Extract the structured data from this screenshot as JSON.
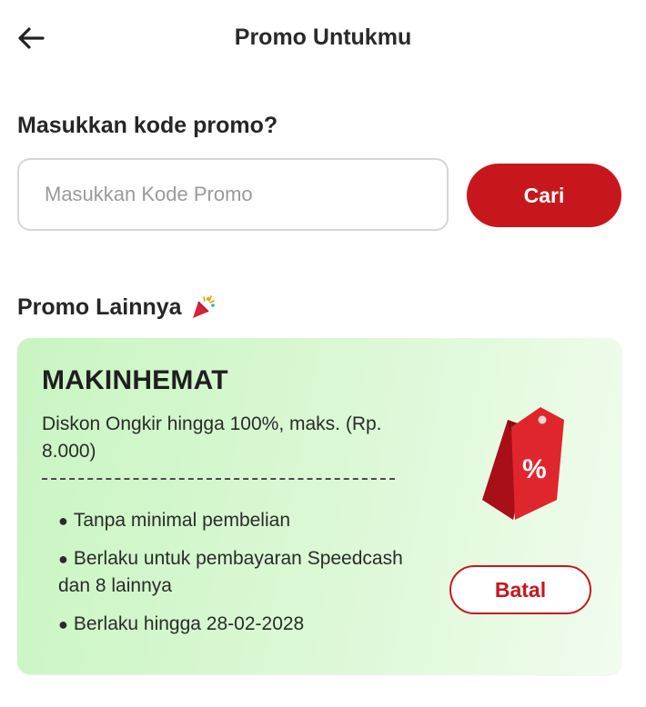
{
  "header": {
    "back_icon": "arrow-left-icon",
    "title": "Promo Untukmu"
  },
  "promo_input": {
    "label": "Masukkan kode promo?",
    "value": "",
    "placeholder": "Masukkan Kode Promo",
    "search_label": "Cari"
  },
  "other_promos": {
    "label": "Promo Lainnya",
    "label_icon": "party-popper-icon",
    "items": [
      {
        "code": "MAKINHEMAT",
        "description": "Diskon Ongkir hingga 100%, maks. (Rp. 8.000)",
        "terms": [
          "Tanpa minimal pembelian",
          "Berlaku untuk pembayaran Speedcash dan 8 lainnya",
          "Berlaku hingga 28-02-2028"
        ],
        "icon": "discount-tag-icon",
        "action_label": "Batal"
      }
    ]
  },
  "colors": {
    "accent": "#c8171c",
    "card_bg_start": "#c9f5c2",
    "card_bg_end": "#f1fcee",
    "text": "#222222"
  }
}
